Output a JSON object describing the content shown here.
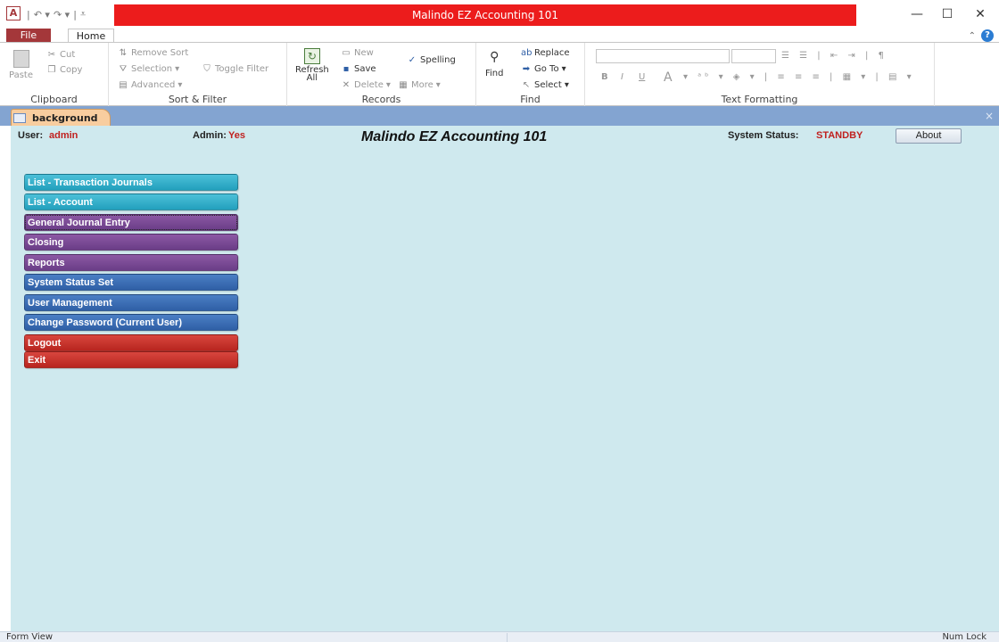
{
  "window": {
    "title": "Malindo EZ Accounting 101",
    "app_icon_letter": "A",
    "minimize": "—",
    "maximize": "☐",
    "close": "✕"
  },
  "tabs": {
    "file": "File",
    "home": "Home"
  },
  "ribbon": {
    "clipboard": {
      "label": "Clipboard",
      "paste": "Paste",
      "cut": "Cut",
      "copy": "Copy"
    },
    "sort_filter": {
      "label": "Sort & Filter",
      "remove_sort": "Remove Sort",
      "selection": "Selection",
      "toggle_filter": "Toggle Filter",
      "advanced": "Advanced"
    },
    "records": {
      "label": "Records",
      "refresh": "Refresh",
      "refresh_all": "All",
      "new": "New",
      "save": "Save",
      "delete": "Delete",
      "spelling": "Spelling",
      "more": "More"
    },
    "find": {
      "label": "Find",
      "find": "Find",
      "replace": "Replace",
      "go_to": "Go To",
      "select": "Select"
    },
    "text_formatting": {
      "label": "Text Formatting",
      "bold": "B",
      "italic": "I",
      "underline": "U",
      "font_color": "A"
    }
  },
  "document": {
    "tab_label": "background",
    "close": "×"
  },
  "form": {
    "user_label": "User:",
    "user_value": "admin",
    "admin_label": "Admin:",
    "admin_value": "Yes",
    "title": "Malindo EZ Accounting 101",
    "status_label": "System Status:",
    "status_value": "STANDBY",
    "about": "About",
    "menu": [
      {
        "label": "List - Transaction Journals",
        "color": "#22a0bd"
      },
      {
        "label": "List - Account",
        "color": "#22a0bd"
      },
      {
        "label": "General Journal Entry",
        "color": "#6a3d87"
      },
      {
        "label": "Closing",
        "color": "#6a3d87"
      },
      {
        "label": "Reports",
        "color": "#6a3d87"
      },
      {
        "label": "System Status Set",
        "color": "#2f5fa6"
      },
      {
        "label": "User Management",
        "color": "#2f5fa6"
      },
      {
        "label": "Change Password (Current User)",
        "color": "#2f5fa6"
      },
      {
        "label": "Logout",
        "color": "#b8251f"
      },
      {
        "label": "Exit",
        "color": "#b8251f"
      }
    ]
  },
  "status_bar": {
    "view": "Form View",
    "num_lock": "Num Lock"
  },
  "icons": [
    "app-access-icon",
    "undo-icon",
    "redo-icon",
    "customize-qat-icon",
    "paste-icon",
    "cut-icon",
    "copy-icon",
    "remove-sort-icon",
    "selection-icon",
    "toggle-filter-icon",
    "advanced-icon",
    "refresh-icon",
    "new-icon",
    "save-icon",
    "delete-icon",
    "spelling-icon",
    "more-icon",
    "find-icon",
    "replace-icon",
    "goto-icon",
    "select-icon",
    "form-icon",
    "help-icon",
    "collapse-ribbon-icon"
  ]
}
